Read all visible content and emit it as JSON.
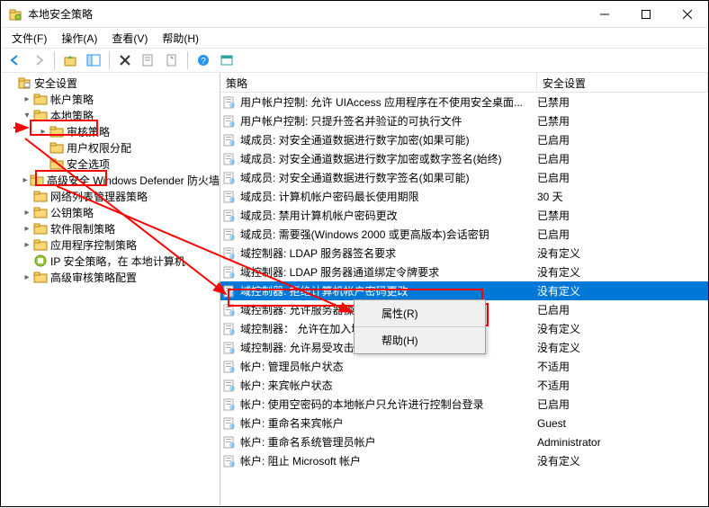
{
  "window": {
    "title": "本地安全策略"
  },
  "menus": {
    "file": "文件(F)",
    "action": "操作(A)",
    "view": "查看(V)",
    "help": "帮助(H)"
  },
  "tree": {
    "root": "安全设置",
    "items": [
      {
        "label": "帐户策略",
        "exp": "▸",
        "level": 2,
        "icon": "folder"
      },
      {
        "label": "本地策略",
        "exp": "▾",
        "level": 2,
        "icon": "folder"
      },
      {
        "label": "审核策略",
        "exp": "▸",
        "level": 3,
        "icon": "folder"
      },
      {
        "label": "用户权限分配",
        "exp": "",
        "level": 3,
        "icon": "folder"
      },
      {
        "label": "安全选项",
        "exp": "",
        "level": 3,
        "icon": "folder"
      },
      {
        "label": "高级安全 Windows Defender 防火墙",
        "exp": "▸",
        "level": 2,
        "icon": "folder"
      },
      {
        "label": "网络列表管理器策略",
        "exp": "",
        "level": 2,
        "icon": "folder-net"
      },
      {
        "label": "公钥策略",
        "exp": "▸",
        "level": 2,
        "icon": "folder"
      },
      {
        "label": "软件限制策略",
        "exp": "▸",
        "level": 2,
        "icon": "folder"
      },
      {
        "label": "应用程序控制策略",
        "exp": "▸",
        "level": 2,
        "icon": "folder"
      },
      {
        "label": "IP 安全策略，在 本地计算机",
        "exp": "",
        "level": 2,
        "icon": "ip"
      },
      {
        "label": "高级审核策略配置",
        "exp": "▸",
        "level": 2,
        "icon": "folder"
      }
    ]
  },
  "columns": {
    "policy": "策略",
    "setting": "安全设置"
  },
  "policies": [
    {
      "name": "用户帐户控制: 允许 UIAccess 应用程序在不使用安全桌面...",
      "setting": "已禁用"
    },
    {
      "name": "用户帐户控制: 只提升签名并验证的可执行文件",
      "setting": "已禁用"
    },
    {
      "name": "域成员: 对安全通道数据进行数字加密(如果可能)",
      "setting": "已启用"
    },
    {
      "name": "域成员: 对安全通道数据进行数字加密或数字签名(始终)",
      "setting": "已启用"
    },
    {
      "name": "域成员: 对安全通道数据进行数字签名(如果可能)",
      "setting": "已启用"
    },
    {
      "name": "域成员: 计算机帐户密码最长使用期限",
      "setting": "30 天"
    },
    {
      "name": "域成员: 禁用计算机帐户密码更改",
      "setting": "已禁用"
    },
    {
      "name": "域成员: 需要强(Windows 2000 或更高版本)会话密钥",
      "setting": "已启用"
    },
    {
      "name": "域控制器: LDAP 服务器签名要求",
      "setting": "没有定义"
    },
    {
      "name": "域控制器: LDAP 服务器通道绑定令牌要求",
      "setting": "没有定义"
    },
    {
      "name": "域控制器: 拒绝计算机帐户密码更改",
      "setting": "没有定义",
      "selected": true
    },
    {
      "name": "域控制器: 允许服务器操作者计划",
      "setting": "已启用"
    },
    {
      "name": "域控制器：  允许在加入域期间重新",
      "setting": "没有定义"
    },
    {
      "name": "域控制器: 允许易受攻击的 Netlogon 安全通道连接",
      "setting": "没有定义"
    },
    {
      "name": "帐户: 管理员帐户状态",
      "setting": "不适用"
    },
    {
      "name": "帐户: 来宾帐户状态",
      "setting": "不适用"
    },
    {
      "name": "帐户: 使用空密码的本地帐户只允许进行控制台登录",
      "setting": "已启用"
    },
    {
      "name": "帐户: 重命名来宾帐户",
      "setting": "Guest"
    },
    {
      "name": "帐户: 重命名系统管理员帐户",
      "setting": "Administrator"
    },
    {
      "name": "帐户: 阻止 Microsoft 帐户",
      "setting": "没有定义"
    }
  ],
  "ctx": {
    "properties": "属性(R)",
    "help": "帮助(H)"
  },
  "colors": {
    "selection": "#0078d7",
    "annotation": "#ff0000"
  }
}
